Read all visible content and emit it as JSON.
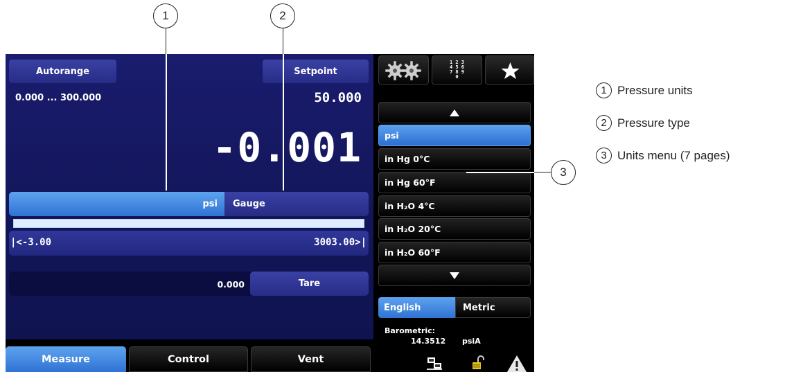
{
  "callouts": [
    "1",
    "2",
    "3"
  ],
  "main": {
    "autorange_label": "Autorange",
    "range_text": "0.000 ... 300.000",
    "setpoint_label": "Setpoint",
    "setpoint_value": "50.000",
    "reading": "-0.001",
    "unit": "psi",
    "pressure_type": "Gauge",
    "range_min": "|<-3.00",
    "range_max": "3003.00>|",
    "tare_value": "0.000",
    "tare_label": "Tare"
  },
  "toolbar": {
    "keypad_digits": [
      "1 2 3",
      "4 5 6",
      "7 8 9",
      "0"
    ]
  },
  "units_menu": {
    "items": [
      "psi",
      "in Hg 0°C",
      "in Hg 60°F",
      "in H₂O 4°C",
      "in H₂O 20°C",
      "in H₂O 60°F"
    ],
    "selected_index": 0
  },
  "unit_system": {
    "english": "English",
    "metric": "Metric",
    "selected": "English"
  },
  "barometric": {
    "label": "Barometric:",
    "value": "14.3512",
    "unit": "psiA"
  },
  "tabs": [
    "Measure",
    "Control",
    "Vent"
  ],
  "legend": [
    {
      "num": "1",
      "text": "Pressure units"
    },
    {
      "num": "2",
      "text": "Pressure type"
    },
    {
      "num": "3",
      "text": "Units menu (7 pages)"
    }
  ],
  "colors": {
    "panel": "#141860",
    "selected_blue": "#3f86e0",
    "device_bg": "#000000"
  }
}
